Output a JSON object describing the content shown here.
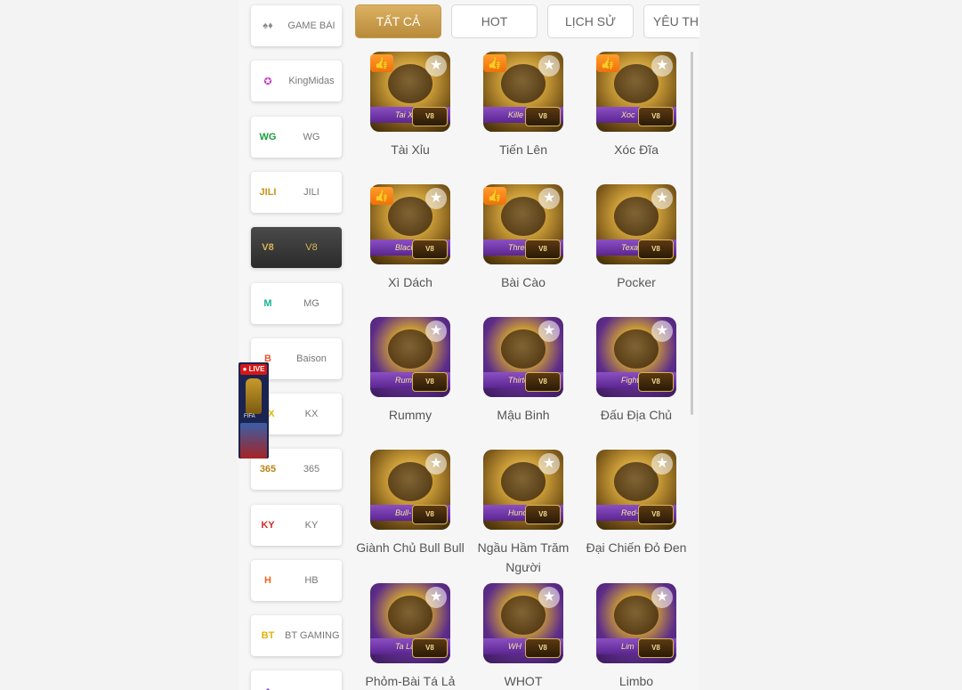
{
  "providers": [
    {
      "label": "GAME BÀI",
      "logo": "♠♦",
      "logo_color": "#8a8a8a",
      "active": false
    },
    {
      "label": "KingMidas",
      "logo": "✪",
      "logo_color": "#c43bbf",
      "active": false
    },
    {
      "label": "WG",
      "logo": "WG",
      "logo_color": "#1b9e3a",
      "active": false
    },
    {
      "label": "JILI",
      "logo": "JILI",
      "logo_color": "#c7951a",
      "active": false
    },
    {
      "label": "V8",
      "logo": "V8",
      "logo_color": "#d8b457",
      "active": true
    },
    {
      "label": "MG",
      "logo": "M",
      "logo_color": "#19b392",
      "active": false
    },
    {
      "label": "Baison",
      "logo": "B",
      "logo_color": "#e4572e",
      "active": false
    },
    {
      "label": "KX",
      "logo": "KX",
      "logo_color": "#e2b90d",
      "active": false
    },
    {
      "label": "365",
      "logo": "365",
      "logo_color": "#b8861c",
      "active": false
    },
    {
      "label": "KY",
      "logo": "KY",
      "logo_color": "#d22b2b",
      "active": false
    },
    {
      "label": "HB",
      "logo": "H",
      "logo_color": "#f0641e",
      "active": false
    },
    {
      "label": "BT GAMING",
      "logo": "BT",
      "logo_color": "#e3b20c",
      "active": false
    },
    {
      "label": "",
      "logo": "◆",
      "logo_color": "#8b5bd6",
      "active": false
    }
  ],
  "live_badge": {
    "tag": "● LIVE",
    "subtitle": "FIFA"
  },
  "tabs": [
    {
      "label": "TẤT CẢ",
      "active": true
    },
    {
      "label": "HOT",
      "active": false
    },
    {
      "label": "LỊCH SỬ",
      "active": false
    },
    {
      "label": "YÊU THÍCH",
      "active": false
    }
  ],
  "games": [
    {
      "name": "Tài Xỉu",
      "ribbon": "Tai X",
      "hot": true,
      "purple": false
    },
    {
      "name": "Tiến Lên",
      "ribbon": "Kille",
      "hot": true,
      "purple": false
    },
    {
      "name": "Xóc Đĩa",
      "ribbon": "Xoc",
      "hot": true,
      "purple": false
    },
    {
      "name": "Xì Dách",
      "ribbon": "Black",
      "hot": true,
      "purple": false
    },
    {
      "name": "Bài Cào",
      "ribbon": "Three",
      "hot": true,
      "purple": false
    },
    {
      "name": "Pocker",
      "ribbon": "Texas Hol Pok",
      "hot": false,
      "purple": false
    },
    {
      "name": "Rummy",
      "ribbon": "Rum",
      "hot": false,
      "purple": true
    },
    {
      "name": "Mậu Binh",
      "ribbon": "Thirteen",
      "hot": false,
      "purple": true
    },
    {
      "name": "Đấu Địa Chủ",
      "ribbon": "Fight the Lan",
      "hot": false,
      "purple": true
    },
    {
      "name": "Giành Chủ Bull Bull",
      "ribbon": "Bull-",
      "hot": false,
      "purple": false
    },
    {
      "name": "Ngầu Hầm Trăm Người",
      "ribbon": "Hundreds Of B",
      "hot": false,
      "purple": false
    },
    {
      "name": "Đại Chiến Đỏ Đen",
      "ribbon": "Red-Bla",
      "hot": false,
      "purple": false
    },
    {
      "name": "Phỏm-Bài Tá Lả",
      "ribbon": "Ta La-",
      "hot": false,
      "purple": true
    },
    {
      "name": "WHOT",
      "ribbon": "WH",
      "hot": false,
      "purple": true
    },
    {
      "name": "Limbo",
      "ribbon": "Lim",
      "hot": false,
      "purple": true
    }
  ],
  "brand_badge": "V8",
  "icons": {
    "hot": "thumbs-up-icon",
    "favorite": "star-icon"
  }
}
